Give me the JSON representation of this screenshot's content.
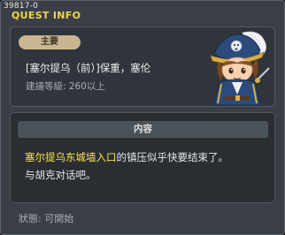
{
  "window": {
    "id_label": "39817-0",
    "title": "QUEST INFO"
  },
  "quest": {
    "badge": "主要",
    "name": "[塞尔提乌（前）]保重，塞伦",
    "level_requirement": "建議等級: 260以上",
    "npc_portrait_icon": "pirate-npc-portrait"
  },
  "content": {
    "header": "内容",
    "highlight_text": "塞尔提乌东城墙入口",
    "text_after_highlight": "的镇压似乎快要结束了。",
    "line2": "与胡克对话吧。"
  },
  "status": {
    "text": "狀態: 可開始"
  },
  "colors": {
    "title": "#f2d54a",
    "highlight": "#f7e64b",
    "badge_bg": "#c9b690"
  }
}
